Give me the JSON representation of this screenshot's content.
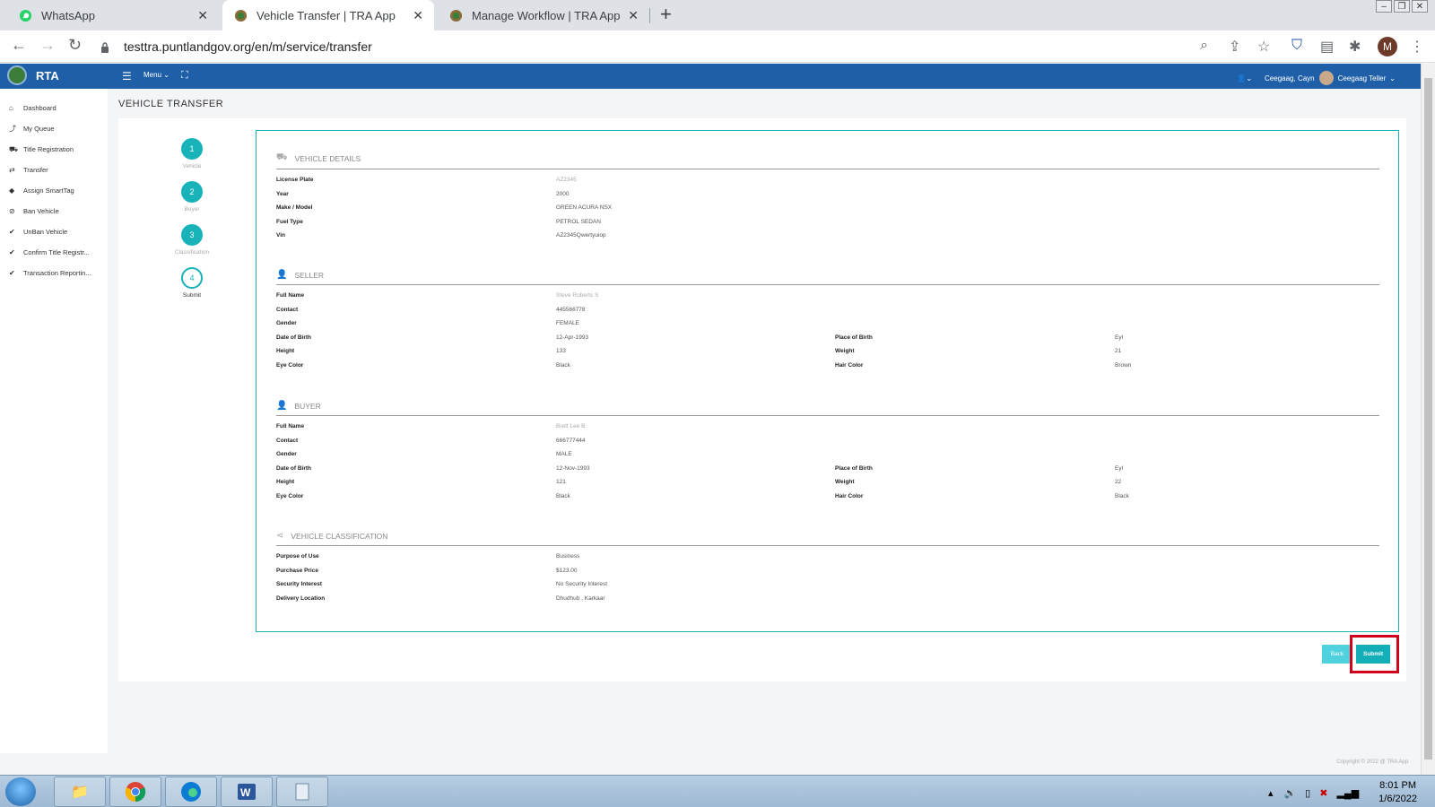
{
  "browser": {
    "tabs": [
      {
        "title": "WhatsApp",
        "active": false
      },
      {
        "title": "Vehicle Transfer | TRA App",
        "active": true
      },
      {
        "title": "Manage Workflow | TRA App",
        "active": false
      }
    ],
    "url": "testtra.puntlandgov.org/en/m/service/transfer",
    "profile_initial": "M"
  },
  "app": {
    "brand": "RTA",
    "menu_label": "Menu",
    "user_short": "Ceegaag, Cayn",
    "user_role": "Ceegaag Teller"
  },
  "sidebar": {
    "items": [
      {
        "label": "Dashboard",
        "icon": "home-icon"
      },
      {
        "label": "My Queue",
        "icon": "chart-line-icon"
      },
      {
        "label": "Title Registration",
        "icon": "car-icon"
      },
      {
        "label": "Transfer",
        "icon": "transfer-icon"
      },
      {
        "label": "Assign SmartTag",
        "icon": "tag-icon"
      },
      {
        "label": "Ban Vehicle",
        "icon": "ban-icon"
      },
      {
        "label": "UnBan Vehicle",
        "icon": "check-icon"
      },
      {
        "label": "Confirm Title Registr...",
        "icon": "check-icon"
      },
      {
        "label": "Transaction Reportin...",
        "icon": "check-icon"
      }
    ]
  },
  "page": {
    "title": "VEHICLE TRANSFER",
    "steps": [
      {
        "number": "1",
        "label": "Vehicle"
      },
      {
        "number": "2",
        "label": "Buyer"
      },
      {
        "number": "3",
        "label": "Classification"
      },
      {
        "number": "4",
        "label": "Submit"
      }
    ],
    "vehicle": {
      "heading": "VEHICLE DETAILS",
      "rows": [
        {
          "k": "License Plate",
          "v": "AZ2345"
        },
        {
          "k": "Year",
          "v": "2000"
        },
        {
          "k": "Make / Model",
          "v": "GREEN ACURA NSX"
        },
        {
          "k": "Fuel Type",
          "v": "PETROL SEDAN"
        },
        {
          "k": "Vin",
          "v": "AZ2345Qwertyuiop"
        }
      ]
    },
    "seller": {
      "heading": "SELLER",
      "full_name_label": "Full Name",
      "full_name": "Steve Roberts S",
      "contact_label": "Contact",
      "contact": "445566778",
      "gender_label": "Gender",
      "gender": "FEMALE",
      "dob_label": "Date of Birth",
      "dob": "12-Apr-1993",
      "pob_label": "Place of Birth",
      "pob": "Eyl",
      "height_label": "Height",
      "height": "133",
      "weight_label": "Weight",
      "weight": "21",
      "eye_label": "Eye Color",
      "eye": "Black",
      "hair_label": "Hair Color",
      "hair": "Brown"
    },
    "buyer": {
      "heading": "BUYER",
      "full_name_label": "Full Name",
      "full_name": "Brett Lee B",
      "contact_label": "Contact",
      "contact": "666777444",
      "gender_label": "Gender",
      "gender": "MALE",
      "dob_label": "Date of Birth",
      "dob": "12-Nov-1993",
      "pob_label": "Place of Birth",
      "pob": "Eyl",
      "height_label": "Height",
      "height": "121",
      "weight_label": "Weight",
      "weight": "22",
      "eye_label": "Eye Color",
      "eye": "Black",
      "hair_label": "Hair Color",
      "hair": "Black"
    },
    "classification": {
      "heading": "VEHICLE CLASSIFICATION",
      "rows": [
        {
          "k": "Purpose of Use",
          "v": "Business"
        },
        {
          "k": "Purchase Price",
          "v": "$123.00"
        },
        {
          "k": "Security Interest",
          "v": "No Security Interest"
        },
        {
          "k": "Delivery Location",
          "v": "Dhudhub , Karkaar"
        }
      ]
    },
    "buttons": {
      "back": "Back",
      "submit": "Submit"
    },
    "copyright": "Copyright © 2022 @ TRA App"
  },
  "taskbar": {
    "time": "8:01 PM",
    "date": "1/6/2022"
  },
  "colors": {
    "header_blue": "#1e5fa8",
    "teal": "#17b3b8",
    "highlight_red": "#d0021b"
  }
}
